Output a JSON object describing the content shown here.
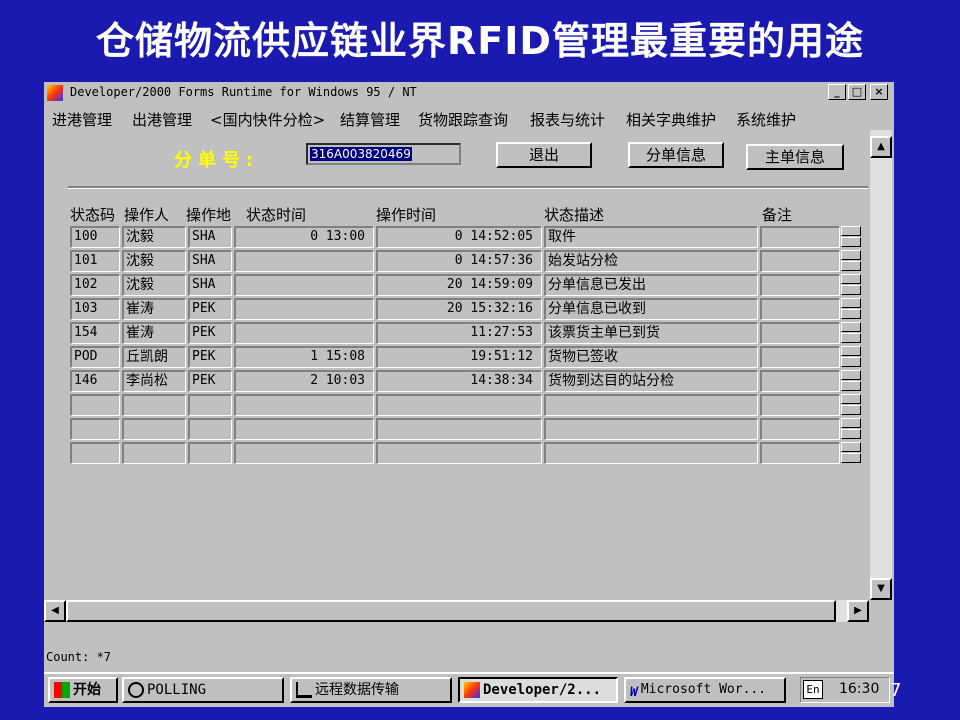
{
  "slide": {
    "title": "仓储物流供应链业界RFID管理最重要的用途",
    "page_number": "7"
  },
  "window": {
    "title": "Developer/2000 Forms Runtime for Windows 95 / NT",
    "controls": [
      "_",
      "□",
      "×"
    ]
  },
  "menu": [
    "进港管理",
    "出港管理",
    "<国内快件分检>",
    "结算管理",
    "货物跟踪查询",
    "报表与统计",
    "相关字典维护",
    "系统维护"
  ],
  "form": {
    "fendan_label": "分单号:",
    "fendan_value": "316A003820469",
    "buttons": {
      "exit": "退出",
      "sub_info": "分单信息",
      "main_info": "主单信息"
    }
  },
  "table": {
    "headers": [
      "状态码",
      "操作人",
      "操作地",
      "状态时间",
      "操作时间",
      "状态描述",
      "备注"
    ],
    "rows": [
      [
        "100",
        "沈毅",
        "SHA",
        "0 13:00",
        "0 14:52:05",
        "取件",
        ""
      ],
      [
        "101",
        "沈毅",
        "SHA",
        "",
        "0 14:57:36",
        "始发站分检",
        ""
      ],
      [
        "102",
        "沈毅",
        "SHA",
        "",
        "20 14:59:09",
        "分单信息已发出",
        ""
      ],
      [
        "103",
        "崔涛",
        "PEK",
        "",
        "20 15:32:16",
        "分单信息已收到",
        ""
      ],
      [
        "154",
        "崔涛",
        "PEK",
        "",
        "11:27:53",
        "该票货主单已到货",
        ""
      ],
      [
        "POD",
        "丘凯朗",
        "PEK",
        "1 15:08",
        "19:51:12",
        "货物已签收",
        ""
      ],
      [
        "146",
        "李尚松",
        "PEK",
        "2 10:03",
        "14:38:34",
        "货物到达目的站分检",
        ""
      ],
      [
        "",
        "",
        "",
        "",
        "",
        "",
        ""
      ],
      [
        "",
        "",
        "",
        "",
        "",
        "",
        ""
      ],
      [
        "",
        "",
        "",
        "",
        "",
        "",
        ""
      ]
    ]
  },
  "status": {
    "count": "Count: *7"
  },
  "taskbar": {
    "start": "开始",
    "tasks": [
      "POLLING",
      "远程数据传输",
      "Developer/2...",
      "Microsoft Wor..."
    ],
    "tray_lang": "En",
    "clock": "16:30"
  },
  "icons": {
    "app": "forms-app-icon",
    "start": "windows-flag-icon"
  }
}
